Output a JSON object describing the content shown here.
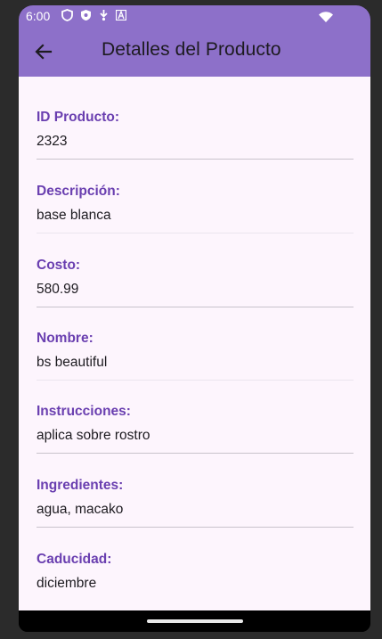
{
  "status_bar": {
    "time": "6:00",
    "icons": [
      "shield-outline-icon",
      "shield-icon",
      "download-icon",
      "font-a-icon",
      "wifi-icon"
    ]
  },
  "app_bar": {
    "title": "Detalles del Producto",
    "back_icon": "arrow-left-icon",
    "background": "#8d70c9"
  },
  "colors": {
    "label": "#6a3fb0",
    "value": "#1d1b20",
    "content_bg": "#fdf5fd"
  },
  "fields": [
    {
      "label": "ID Producto:",
      "value": "2323"
    },
    {
      "label": "Descripción:",
      "value": "base blanca"
    },
    {
      "label": "Costo:",
      "value": "580.99"
    },
    {
      "label": "Nombre:",
      "value": "bs beautiful"
    },
    {
      "label": "Instrucciones:",
      "value": "aplica sobre rostro"
    },
    {
      "label": "Ingredientes:",
      "value": "agua, macako"
    },
    {
      "label": "Caducidad:",
      "value": "diciembre"
    }
  ]
}
